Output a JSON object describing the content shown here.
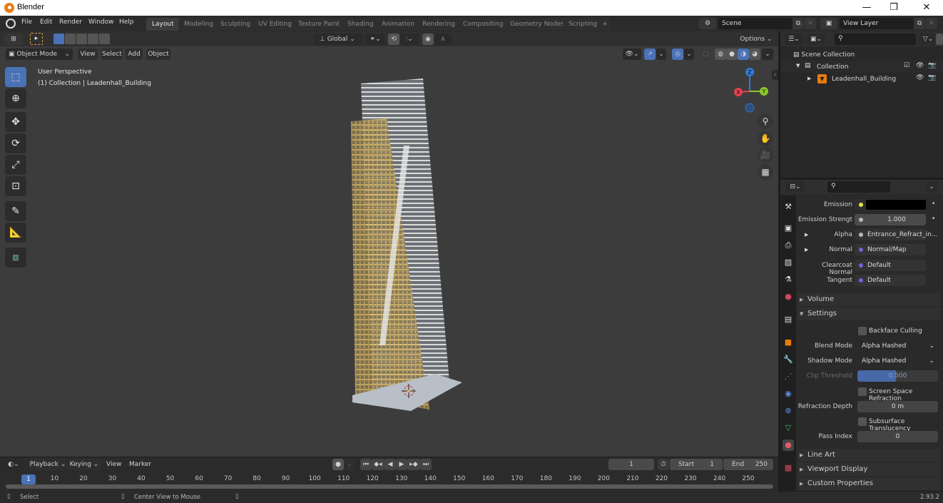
{
  "window": {
    "title": "Blender",
    "minimize": "—",
    "maximize": "❐",
    "close": "✕"
  },
  "menu": [
    "File",
    "Edit",
    "Render",
    "Window",
    "Help"
  ],
  "workspaces": [
    {
      "label": "Layout",
      "active": true
    },
    {
      "label": "Modeling"
    },
    {
      "label": "Sculpting"
    },
    {
      "label": "UV Editing"
    },
    {
      "label": "Texture Paint"
    },
    {
      "label": "Shading"
    },
    {
      "label": "Animation"
    },
    {
      "label": "Rendering"
    },
    {
      "label": "Compositing"
    },
    {
      "label": "Geometry Nodes"
    },
    {
      "label": "Scripting"
    }
  ],
  "add_workspace": "+",
  "scene": {
    "label": "Scene",
    "view_layer": "View Layer"
  },
  "tool_header": {
    "transform_orientation": "Global",
    "options": "Options"
  },
  "viewport_header": {
    "mode": "Object Mode",
    "menus": [
      "View",
      "Select",
      "Add",
      "Object"
    ]
  },
  "viewport": {
    "perspective": "User Perspective",
    "collection_info": "(1) Collection | Leadenhall_Building",
    "gizmo": {
      "x": "X",
      "y": "Y",
      "z": "Z"
    },
    "colors": {
      "x": "#e44155",
      "y": "#8ac926",
      "z": "#2f7bd8"
    }
  },
  "outliner": {
    "root": "Scene Collection",
    "collection": "Collection",
    "object": "Leadenhall_Building"
  },
  "properties": {
    "rows": [
      {
        "label": "Emission",
        "value": "",
        "socket": "#e5e53b",
        "type": "color"
      },
      {
        "label": "Emission Strengt",
        "value": "1.000",
        "socket": "#b9b9b9",
        "type": "number"
      },
      {
        "label": "Alpha",
        "value": "Entrance_Refract_in...",
        "socket": "#b9b9b9",
        "type": "link",
        "expand": true
      },
      {
        "label": "Normal",
        "value": "Normal/Map",
        "socket": "#6e63d9",
        "type": "link",
        "expand": true
      },
      {
        "label": "Clearcoat Normal",
        "value": "Default",
        "socket": "#6e63d9",
        "type": "link"
      },
      {
        "label": "Tangent",
        "value": "Default",
        "socket": "#6e63d9",
        "type": "link"
      }
    ],
    "panels": {
      "volume": "Volume",
      "settings": "Settings",
      "line_art": "Line Art",
      "viewport_display": "Viewport Display",
      "custom_properties": "Custom Properties"
    },
    "settings": {
      "backface_culling": "Backface Culling",
      "blend_mode_label": "Blend Mode",
      "blend_mode": "Alpha Hashed",
      "shadow_mode_label": "Shadow Mode",
      "shadow_mode": "Alpha Hashed",
      "clip_threshold_label": "Clip Threshold",
      "clip_threshold": "0.500",
      "clip_threshold_fraction": 0.5,
      "screen_space_refraction": "Screen Space Refraction",
      "refraction_depth_label": "Refraction Depth",
      "refraction_depth": "0 m",
      "subsurface_translucency": "Subsurface Translucency",
      "pass_index_label": "Pass Index",
      "pass_index": "0"
    }
  },
  "timeline": {
    "menus": [
      "Playback",
      "Keying",
      "View",
      "Marker"
    ],
    "current_frame": "1",
    "start_label": "Start",
    "start": "1",
    "end_label": "End",
    "end": "250",
    "ticks": [
      "1",
      "10",
      "20",
      "30",
      "40",
      "50",
      "60",
      "70",
      "80",
      "90",
      "100",
      "110",
      "120",
      "130",
      "140",
      "150",
      "160",
      "170",
      "180",
      "190",
      "200",
      "210",
      "220",
      "230",
      "240",
      "250"
    ]
  },
  "status": {
    "left": "Select",
    "middle": "Center View to Mouse",
    "version": "2.93.2"
  }
}
